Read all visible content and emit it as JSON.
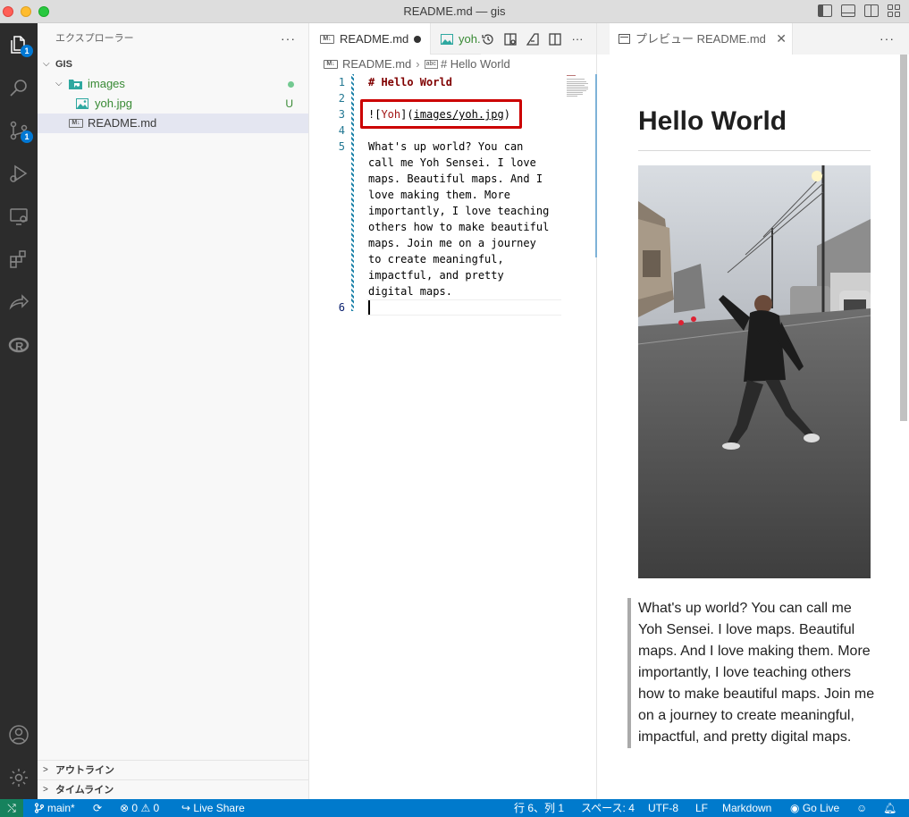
{
  "window": {
    "title": "README.md — gis"
  },
  "activity_bar": {
    "explorer_badge": "1",
    "scm_badge": "1",
    "icons": [
      "files-icon",
      "search-icon",
      "source-control-icon",
      "run-debug-icon",
      "remote-explorer-icon",
      "extensions-icon",
      "live-share-icon",
      "r-icon",
      "account-icon",
      "settings-gear-icon"
    ]
  },
  "sidebar": {
    "header": "エクスプローラー",
    "root": "GIS",
    "tree": [
      {
        "label": "images",
        "type": "folder",
        "status": "dot"
      },
      {
        "label": "yoh.jpg",
        "type": "image",
        "status": "U"
      },
      {
        "label": "README.md",
        "type": "markdown",
        "status": ""
      }
    ],
    "outline": "アウトライン",
    "timeline": "タイムライン"
  },
  "editor": {
    "tabs": [
      {
        "label": "README.md",
        "dirty": true
      },
      {
        "label": "yoh."
      }
    ],
    "breadcrumb": {
      "file": "README.md",
      "symbol": "# Hello World"
    },
    "lines": [
      {
        "num": "1",
        "text": "# Hello World"
      },
      {
        "num": "2",
        "text": ""
      },
      {
        "num": "3",
        "parts": [
          "![",
          "Yoh",
          "](",
          "images/yoh.jpg",
          ")"
        ]
      },
      {
        "num": "4",
        "text": ""
      },
      {
        "num": "5",
        "wrapped": [
          "What's up world? You can",
          "call me Yoh Sensei. I love",
          "maps. Beautiful maps. And I",
          "love making them. More",
          "importantly, I love teaching",
          "others how to make beautiful",
          "maps. Join me on a journey",
          "to create meaningful,",
          "impactful, and pretty",
          "digital maps."
        ]
      },
      {
        "num": "6",
        "text": ""
      }
    ]
  },
  "preview": {
    "tab_label": "プレビュー README.md",
    "heading": "Hello World",
    "paragraph": "What's up world? You can call me Yoh Sensei. I love maps. Beautiful maps. And I love making them. More importantly, I love teaching others how to make beautiful maps. Join me on a journey to create meaningful, impactful, and pretty digital maps."
  },
  "statusbar": {
    "branch": "main*",
    "errors": "0",
    "warnings": "0",
    "live_share": "Live Share",
    "position": "行 6、列 1",
    "spaces": "スペース: 4",
    "encoding": "UTF-8",
    "eol": "LF",
    "language": "Markdown",
    "go_live": "Go Live"
  },
  "colors": {
    "status_bar": "#007acc",
    "remote": "#16825d",
    "highlight_box": "#cc0000"
  }
}
